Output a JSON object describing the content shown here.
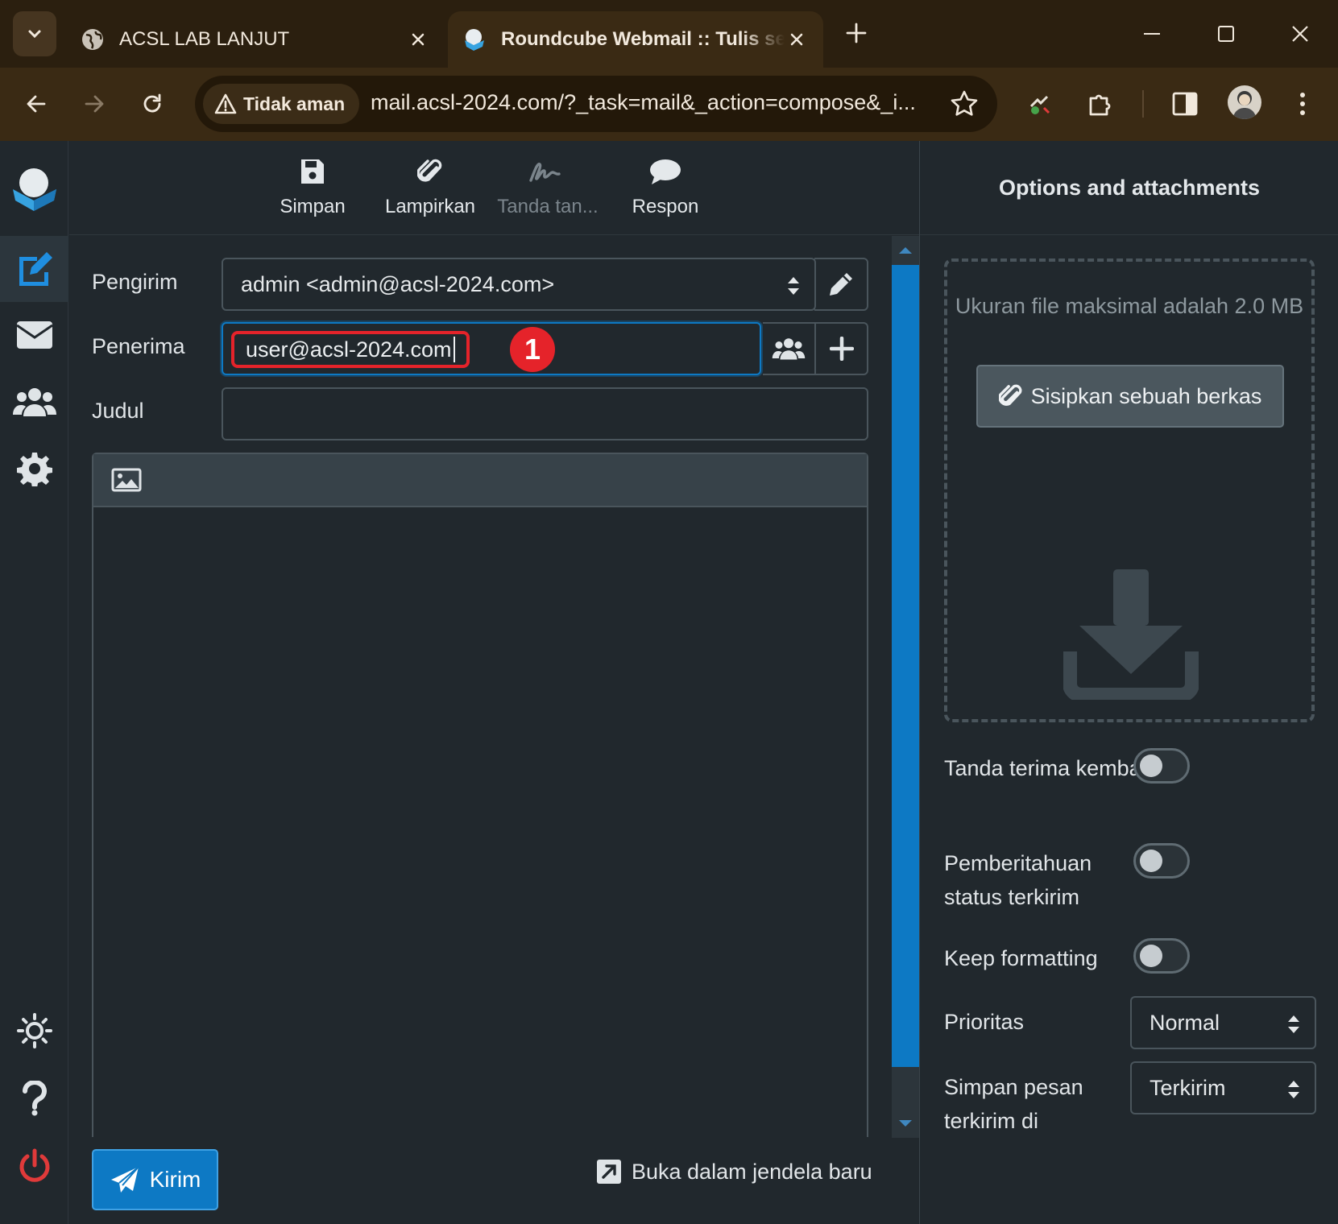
{
  "browser": {
    "tabs": [
      {
        "title": "ACSL LAB LANJUT",
        "active": false
      },
      {
        "title": "Roundcube Webmail :: Tulis sel",
        "active": true
      }
    ],
    "security_label": "Tidak aman",
    "url": "mail.acsl-2024.com/?_task=mail&_action=compose&_i..."
  },
  "toolbar": {
    "save_label": "Simpan",
    "attach_label": "Lampirkan",
    "signature_label": "Tanda tan...",
    "responses_label": "Respon"
  },
  "compose": {
    "sender_label": "Pengirim",
    "sender_value": "admin <admin@acsl-2024.com>",
    "recipient_label": "Penerima",
    "recipient_value": "user@acsl-2024.com",
    "annotation_number": "1",
    "subject_label": "Judul",
    "subject_value": "",
    "send_label": "Kirim",
    "new_window_label": "Buka dalam jendela baru"
  },
  "options_panel": {
    "title": "Options and attachments",
    "max_size_hint": "Ukuran file maksimal adalah 2.0 MB",
    "attach_button_label": "Sisipkan sebuah berkas",
    "return_receipt_label": "Tanda terima kembali",
    "return_receipt_on": false,
    "dsn_label": "Pemberitahuan status terkirim",
    "dsn_on": false,
    "keep_formatting_label": "Keep formatting",
    "keep_formatting_on": false,
    "priority_label": "Prioritas",
    "priority_value": "Normal",
    "save_sent_label": "Simpan pesan terkirim di",
    "save_sent_value": "Terkirim"
  },
  "colors": {
    "accent": "#0d79c4",
    "annotation": "#e5232a",
    "app_background": "#21282d",
    "browser_frame": "#3a2a14"
  }
}
